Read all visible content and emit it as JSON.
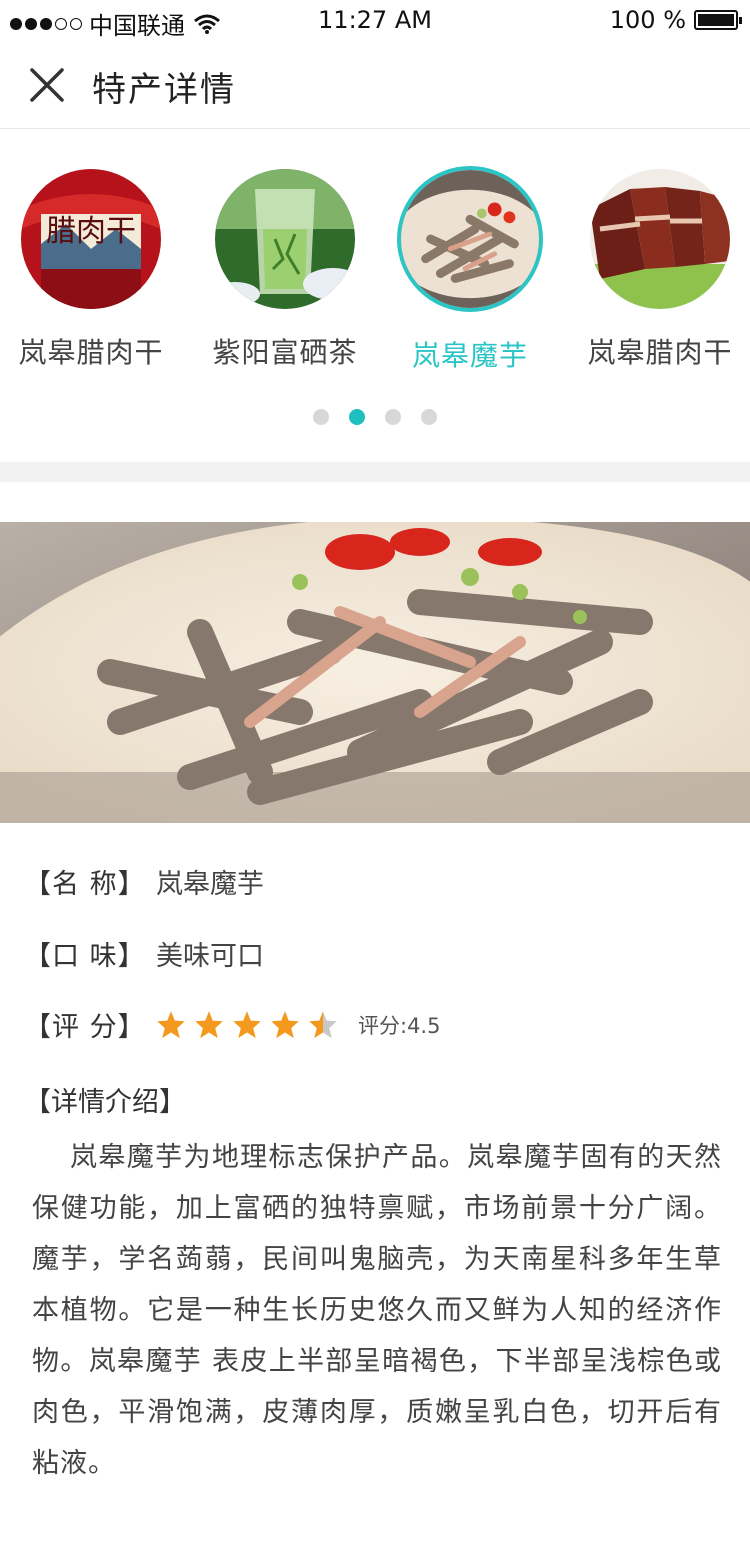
{
  "status_bar": {
    "carrier": "中国联通",
    "time": "11:27 AM",
    "battery": "100 %"
  },
  "nav": {
    "title": "特产详情"
  },
  "carousel": {
    "items": [
      {
        "label": "岚皋腊肉干"
      },
      {
        "label": "紫阳富硒茶"
      },
      {
        "label": "岚皋魔芋"
      },
      {
        "label": "岚皋腊肉干"
      }
    ],
    "active_index": 2,
    "page_count": 4,
    "active_page": 1
  },
  "detail": {
    "name_label": "【名 称】",
    "name_value": "岚皋魔芋",
    "taste_label": "【口 味】",
    "taste_value": "美味可口",
    "rating_label": "【评 分】",
    "rating": 4.5,
    "rating_text": "评分:4.5",
    "intro_label": "【详情介绍】",
    "intro_text": "岚皋魔芋为地理标志保护产品。岚皋魔芋固有的天然保健功能，加上富硒的独特禀赋，市场前景十分广阔。魔芋，学名蒟蒻，民间叫鬼脑壳，为天南星科多年生草本植物。它是一种生长历史悠久而又鲜为人知的经济作物。岚皋魔芋 表皮上半部呈暗褐色，下半部呈浅棕色或肉色，平滑饱满，皮薄肉厚，质嫩呈乳白色，切开后有粘液。"
  },
  "colors": {
    "accent": "#2cc5c5",
    "star": "#f39a1e"
  }
}
